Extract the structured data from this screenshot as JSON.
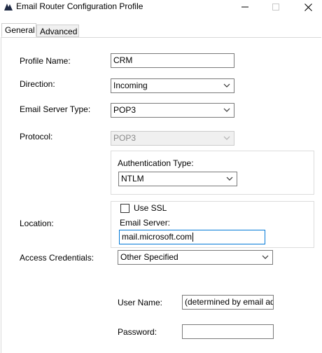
{
  "window": {
    "title": "Email Router Configuration Profile",
    "app_icon": "dynamics-crm-icon",
    "controls": [
      "minimize-icon",
      "maximize-icon",
      "close-icon"
    ]
  },
  "tabs": [
    {
      "label": "General",
      "selected": true
    },
    {
      "label": "Advanced",
      "selected": false
    }
  ],
  "form": {
    "profile_name_label": "Profile Name:",
    "profile_name_value": "CRM",
    "direction_label": "Direction:",
    "direction_value": "Incoming",
    "server_type_label": "Email Server Type:",
    "server_type_value": "POP3",
    "protocol_label": "Protocol:",
    "protocol_value": "POP3",
    "auth_type_label": "Authentication Type:",
    "auth_type_value": "NTLM",
    "use_ssl_label": "Use SSL",
    "use_ssl_checked": false,
    "location_label": "Location:",
    "email_server_label": "Email Server:",
    "email_server_value": "mail.microsoft.com",
    "access_credentials_label": "Access Credentials:",
    "access_credentials_value": "Other Specified",
    "user_name_label": "User Name:",
    "user_name_value": "(determined by email address)",
    "password_label": "Password:",
    "password_value": ""
  },
  "colors": {
    "border": "#7a7a7a",
    "focus_border": "#0078d7",
    "disabled_bg": "#f0f0f0",
    "disabled_text": "#8a8a8a"
  }
}
